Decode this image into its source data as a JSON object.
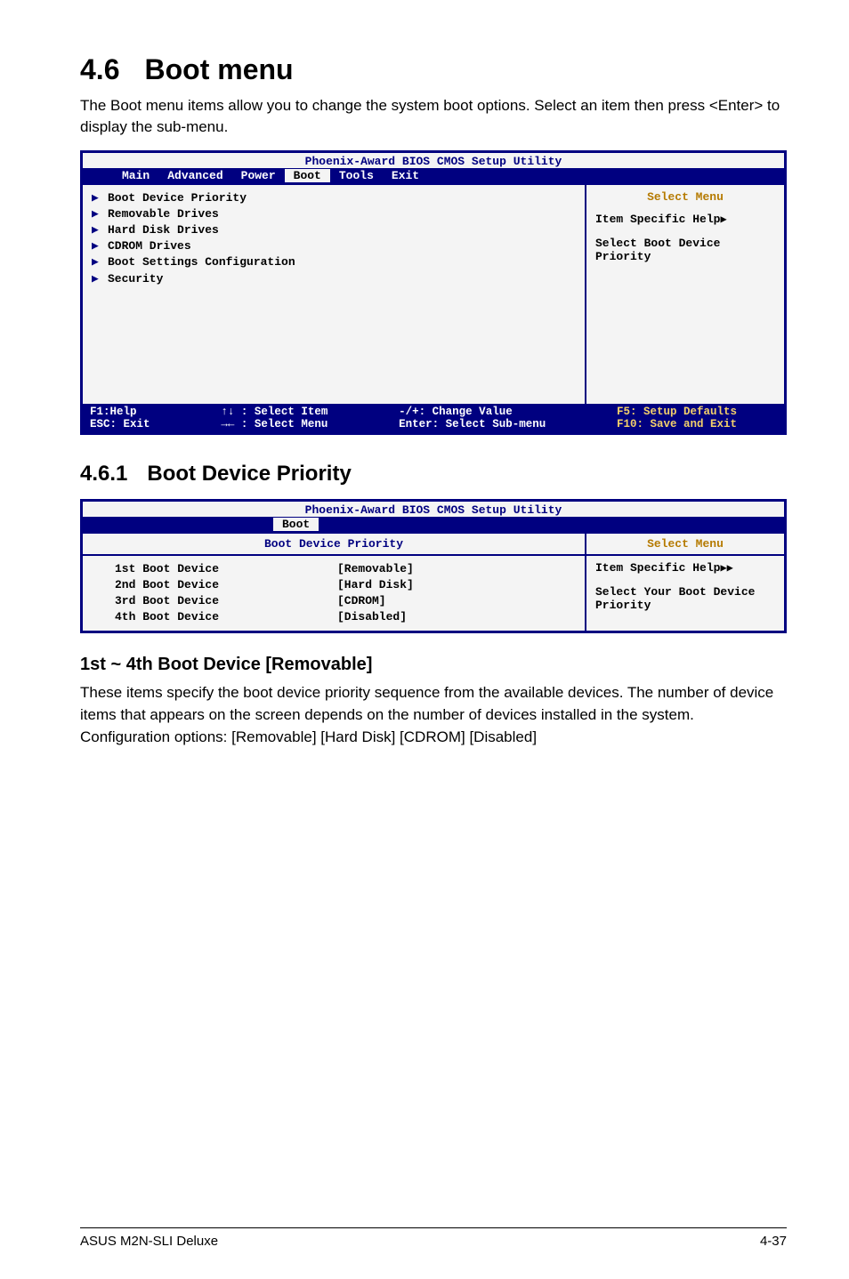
{
  "section": {
    "num": "4.6",
    "title": "Boot menu"
  },
  "intro": "The Boot menu items allow you to change the system boot options. Select an item then press <Enter> to display the sub-menu.",
  "bios1": {
    "title": "Phoenix-Award BIOS CMOS Setup Utility",
    "tabs": [
      "Main",
      "Advanced",
      "Power",
      "Boot",
      "Tools",
      "Exit"
    ],
    "activeTab": "Boot",
    "items": [
      "Boot Device Priority",
      "Removable Drives",
      "Hard Disk Drives",
      "CDROM Drives",
      "Boot Settings Configuration",
      "Security"
    ],
    "right": {
      "header": "Select Menu",
      "help1": "Item Specific Help",
      "help2": "Select Boot Device Priority"
    },
    "footer": {
      "c1": "F1:Help\nESC: Exit",
      "c2": "↑↓ : Select Item\n→← : Select Menu",
      "c3": "-/+: Change Value\nEnter: Select Sub-menu",
      "c4": "F5: Setup Defaults\nF10: Save and Exit"
    }
  },
  "subsection": {
    "num": "4.6.1",
    "title": "Boot Device Priority"
  },
  "bios2": {
    "title": "Phoenix-Award BIOS CMOS Setup Utility",
    "tab": "Boot",
    "heading": "Boot Device Priority",
    "rows": [
      {
        "label": "1st Boot Device",
        "value": "[Removable]"
      },
      {
        "label": "2nd Boot Device",
        "value": "[Hard Disk]"
      },
      {
        "label": "3rd Boot Device",
        "value": "[CDROM]"
      },
      {
        "label": "4th Boot Device",
        "value": "[Disabled]"
      }
    ],
    "right": {
      "header": "Select Menu",
      "help1": "Item Specific Help",
      "help2": "Select Your Boot Device Priority"
    }
  },
  "sub3": "1st ~ 4th Boot Device [Removable]",
  "sub3text": "These items specify the boot device priority sequence from the available devices. The number of device items that appears on the screen depends on the number of devices installed in the system. Configuration options: [Removable] [Hard Disk] [CDROM] [Disabled]",
  "footer": {
    "left": "ASUS M2N-SLI Deluxe",
    "right": "4-37"
  }
}
